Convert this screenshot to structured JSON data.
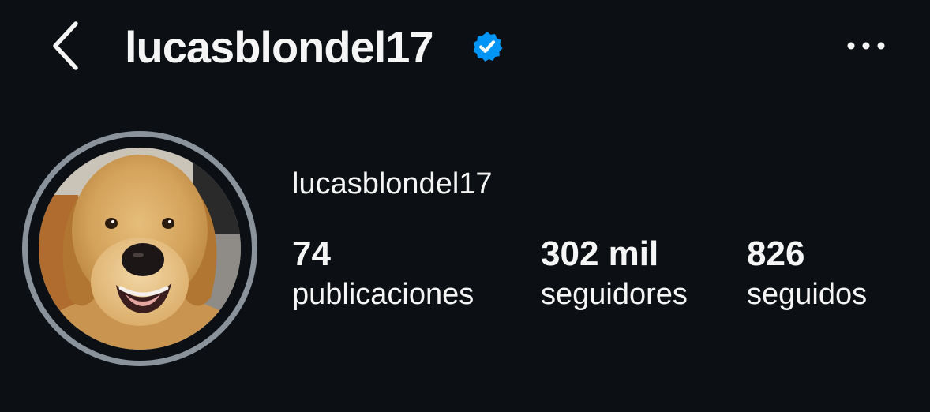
{
  "header": {
    "title": "lucasblondel17",
    "back_icon": "chevron-left-icon",
    "verified_icon": "verified-badge-icon",
    "more_icon": "more-horizontal-icon"
  },
  "profile": {
    "name": "lucasblondel17",
    "avatar_description": "golden-retriever-photo"
  },
  "stats": {
    "posts": {
      "value": "74",
      "label": "publicaciones"
    },
    "followers": {
      "value": "302 mil",
      "label": "seguidores"
    },
    "following": {
      "value": "826",
      "label": "seguidos"
    }
  },
  "colors": {
    "background": "#0c1014",
    "text": "#f5f5f5",
    "verified_blue": "#0095f6",
    "story_ring": "#8a929c"
  }
}
